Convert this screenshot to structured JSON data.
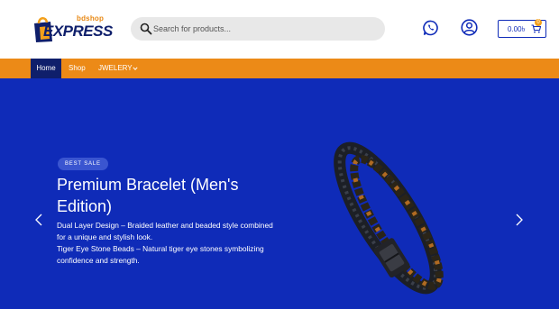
{
  "header": {
    "logo_small": "bdshop",
    "logo_big": "EXPRESS",
    "search_placeholder": "Search for products...",
    "cart_amount": "0.00৳",
    "cart_count": "0"
  },
  "nav": {
    "items": [
      {
        "label": "Home"
      },
      {
        "label": "Shop"
      },
      {
        "label": "JWELERY"
      }
    ]
  },
  "hero": {
    "badge": "BEST SALE",
    "title": "Premium Bracelet (Men's Edition)",
    "desc_lines": [
      "Dual Layer Design – Braided leather and beaded style combined for a unique and stylish look.",
      "Tiger Eye Stone Beads – Natural tiger eye stones symbolizing confidence and strength."
    ]
  },
  "colors": {
    "brand_navy": "#0f1f6b",
    "nav_orange": "#ec8a17",
    "hero_blue": "#0f2bb8",
    "accent_orange": "#f3a01b"
  },
  "icons": {
    "search": "search-icon",
    "whatsapp": "whatsapp-icon",
    "user": "user-icon",
    "cart": "cart-icon",
    "chevron": "chevron-down-icon",
    "prev": "chevron-left-icon",
    "next": "chevron-right-icon"
  }
}
